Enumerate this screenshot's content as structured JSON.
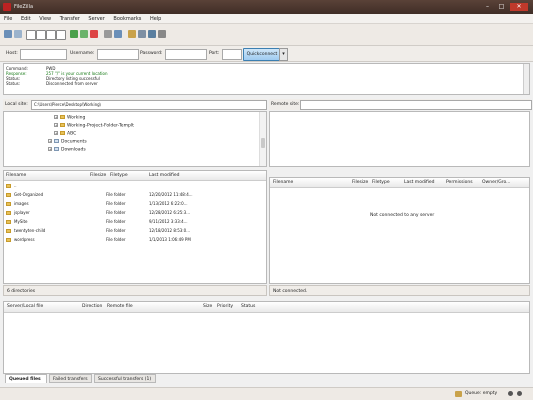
{
  "window": {
    "title": "FileZilla",
    "min": "–",
    "max": "□",
    "close": "✕"
  },
  "menu": [
    "File",
    "Edit",
    "View",
    "Transfer",
    "Server",
    "Bookmarks",
    "Help"
  ],
  "quickconnect": {
    "host_label": "Host:",
    "user_label": "Username:",
    "pass_label": "Password:",
    "port_label": "Port:",
    "host_value": "",
    "user_value": "",
    "pass_value": "",
    "port_value": "",
    "button": "Quickconnect",
    "dropdown": "▾"
  },
  "log": [
    {
      "key": "Command:",
      "value": "PWD",
      "color": "#222222"
    },
    {
      "key": "Response:",
      "value": "257 \"/\" is your current location",
      "color": "#117711"
    },
    {
      "key": "Status:",
      "value": "Directory listing successful",
      "color": "#222222"
    },
    {
      "key": "Status:",
      "value": "Disconnected from server",
      "color": "#222222"
    }
  ],
  "local": {
    "site_label": "Local site:",
    "site_value": "C:\\Users\\Pierce\\Desktop\\Working\\",
    "tree": [
      {
        "label": "Working",
        "indent": 2
      },
      {
        "label": "Working-Project-Folder-Templt",
        "indent": 2
      },
      {
        "label": "ABC",
        "indent": 2
      },
      {
        "label": "Documents",
        "indent": 1
      },
      {
        "label": "Downloads",
        "indent": 1
      }
    ],
    "columns": [
      "Filename",
      "Filesize",
      "Filetype",
      "Last modified"
    ],
    "files": [
      {
        "name": "..",
        "size": "",
        "type": "",
        "modified": ""
      },
      {
        "name": "Get-Organized",
        "size": "",
        "type": "File folder",
        "modified": "12/20/2012 11:48:4..."
      },
      {
        "name": "images",
        "size": "",
        "type": "File folder",
        "modified": "1/13/2012 6:22:0..."
      },
      {
        "name": "jsplayer",
        "size": "",
        "type": "File folder",
        "modified": "12/28/2012 6:25:3..."
      },
      {
        "name": "MySite",
        "size": "",
        "type": "File folder",
        "modified": "9/11/2012 3:33:4..."
      },
      {
        "name": "twentyten-child",
        "size": "",
        "type": "File folder",
        "modified": "12/18/2012 8:53:0..."
      },
      {
        "name": "wordpress",
        "size": "",
        "type": "File folder",
        "modified": "1/1/2013 1:06:49 PM"
      }
    ],
    "status": "6 directories"
  },
  "remote": {
    "site_label": "Remote site:",
    "site_value": "",
    "columns": [
      "Filename",
      "Filesize",
      "Filetype",
      "Last modified",
      "Permissions",
      "Owner/Gro..."
    ],
    "empty_message": "Not connected to any server",
    "status": "Not connected."
  },
  "queue": {
    "columns": [
      "Server/Local file",
      "Direction",
      "Remote file",
      "Size",
      "Priority",
      "Status"
    ],
    "tabs": [
      "Queued files",
      "Failed transfers",
      "Successful transfers (1)"
    ],
    "status_text": "Queue: empty"
  },
  "colors": {
    "accent": "#3c7fb1",
    "folder": "#e8c25a",
    "title_bar": "#4a362e"
  }
}
